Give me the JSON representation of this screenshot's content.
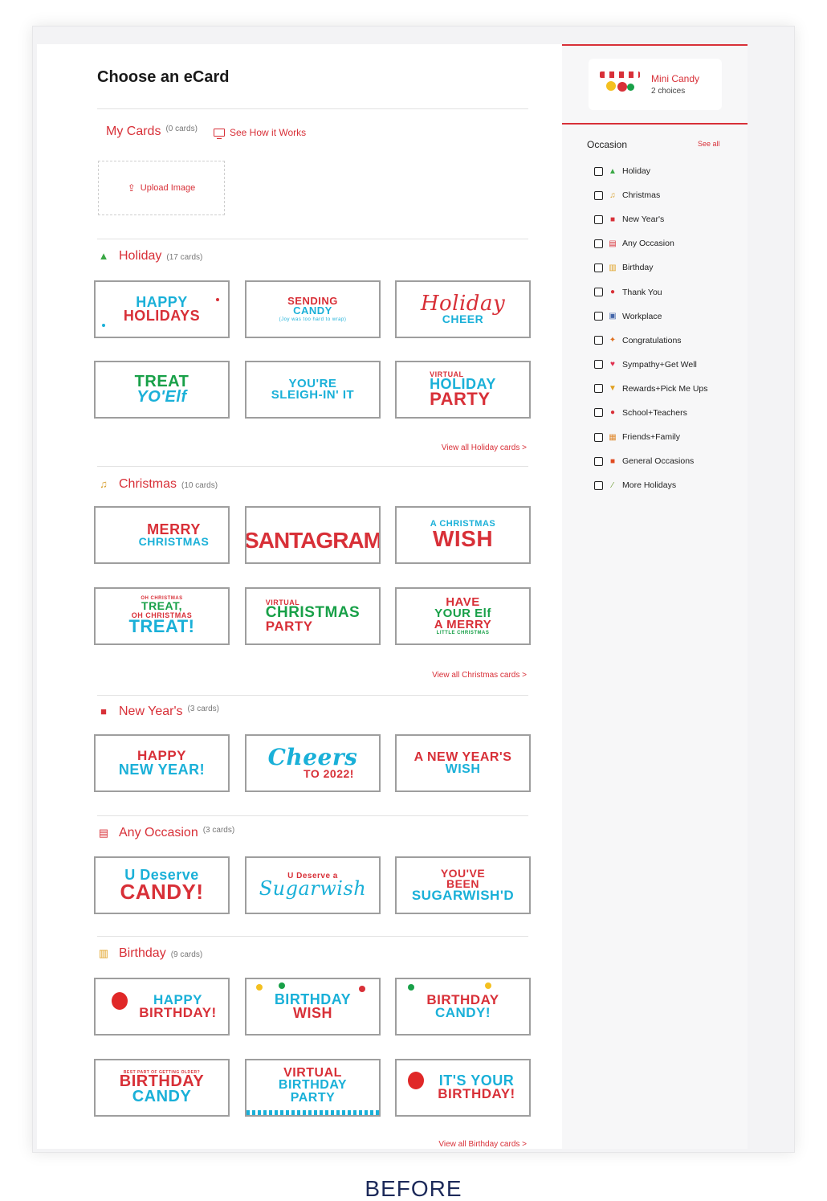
{
  "page": {
    "title": "Choose an eCard",
    "caption": "BEFORE"
  },
  "my_cards": {
    "label": "My Cards",
    "count": "(0 cards)",
    "how_label": "See How it Works",
    "upload_label": "Upload Image"
  },
  "sections": {
    "holiday": {
      "title": "Holiday",
      "count": "(17 cards)",
      "view_all": "View all Holiday cards >",
      "cards": [
        [
          "HAPPY",
          "HOLIDAYS"
        ],
        [
          "SENDING",
          "CANDY",
          "(Joy was too hard to wrap)"
        ],
        [
          "Holiday",
          "CHEER"
        ],
        [
          "TREAT",
          "YO'Elf"
        ],
        [
          "YOU'RE",
          "SLEIGH-IN' IT"
        ],
        [
          "VIRTUAL",
          "HOLIDAY",
          "PARTY"
        ]
      ]
    },
    "christmas": {
      "title": "Christmas",
      "count": "(10 cards)",
      "view_all": "View all Christmas cards >",
      "cards": [
        [
          "MERRY",
          "CHRISTMAS"
        ],
        [
          "SANTAGRAM"
        ],
        [
          "A CHRISTMAS",
          "WISH"
        ],
        [
          "OH CHRISTMAS",
          "TREAT,",
          "OH CHRISTMAS",
          "TREAT!"
        ],
        [
          "VIRTUAL",
          "CHRISTMAS",
          "PARTY"
        ],
        [
          "HAVE",
          "YOUR Elf",
          "A MERRY",
          "LITTLE CHRISTMAS"
        ]
      ]
    },
    "new_year": {
      "title": "New Year's",
      "count": "(3 cards)",
      "cards": [
        [
          "HAPPY",
          "NEW YEAR!"
        ],
        [
          "Cheers",
          "TO 2022!"
        ],
        [
          "A NEW YEAR'S",
          "WISH"
        ]
      ]
    },
    "any_occasion": {
      "title": "Any Occasion",
      "count": "(3 cards)",
      "cards": [
        [
          "U Deserve",
          "CANDY!"
        ],
        [
          "U Deserve a",
          "Sugarwish"
        ],
        [
          "YOU'VE",
          "BEEN",
          "SUGARWISH'D"
        ]
      ]
    },
    "birthday": {
      "title": "Birthday",
      "count": "(9 cards)",
      "view_all": "View all Birthday cards >",
      "cards": [
        [
          "HAPPY",
          "BIRTHDAY!"
        ],
        [
          "BIRTHDAY",
          "WISH"
        ],
        [
          "BIRTHDAY",
          "CANDY!"
        ],
        [
          "BEST PART OF GETTING OLDER?",
          "BIRTHDAY",
          "CANDY"
        ],
        [
          "VIRTUAL",
          "BIRTHDAY",
          "PARTY"
        ],
        [
          "IT'S YOUR",
          "BIRTHDAY!"
        ]
      ]
    }
  },
  "sidebar": {
    "product": {
      "name": "Mini Candy",
      "choices": "2 choices"
    },
    "occasion_title": "Occasion",
    "see_all": "See all",
    "occasions": [
      {
        "label": "Holiday",
        "icon": "tree-icon"
      },
      {
        "label": "Christmas",
        "icon": "bells-icon"
      },
      {
        "label": "New Year's",
        "icon": "gift-bag-icon"
      },
      {
        "label": "Any Occasion",
        "icon": "calendar-icon"
      },
      {
        "label": "Birthday",
        "icon": "cake-icon"
      },
      {
        "label": "Thank You",
        "icon": "pin-icon"
      },
      {
        "label": "Workplace",
        "icon": "computer-icon"
      },
      {
        "label": "Congratulations",
        "icon": "party-popper-icon"
      },
      {
        "label": "Sympathy+Get Well",
        "icon": "heart-icon"
      },
      {
        "label": "Rewards+Pick Me Ups",
        "icon": "trophy-icon"
      },
      {
        "label": "School+Teachers",
        "icon": "apple-icon"
      },
      {
        "label": "Friends+Family",
        "icon": "photo-icon"
      },
      {
        "label": "General Occasions",
        "icon": "present-icon"
      },
      {
        "label": "More Holidays",
        "icon": "wand-icon"
      }
    ]
  },
  "colors": {
    "accent": "#d83038",
    "blue": "#1ab0d8",
    "green": "#18a048",
    "navy": "#1d2a5a"
  }
}
